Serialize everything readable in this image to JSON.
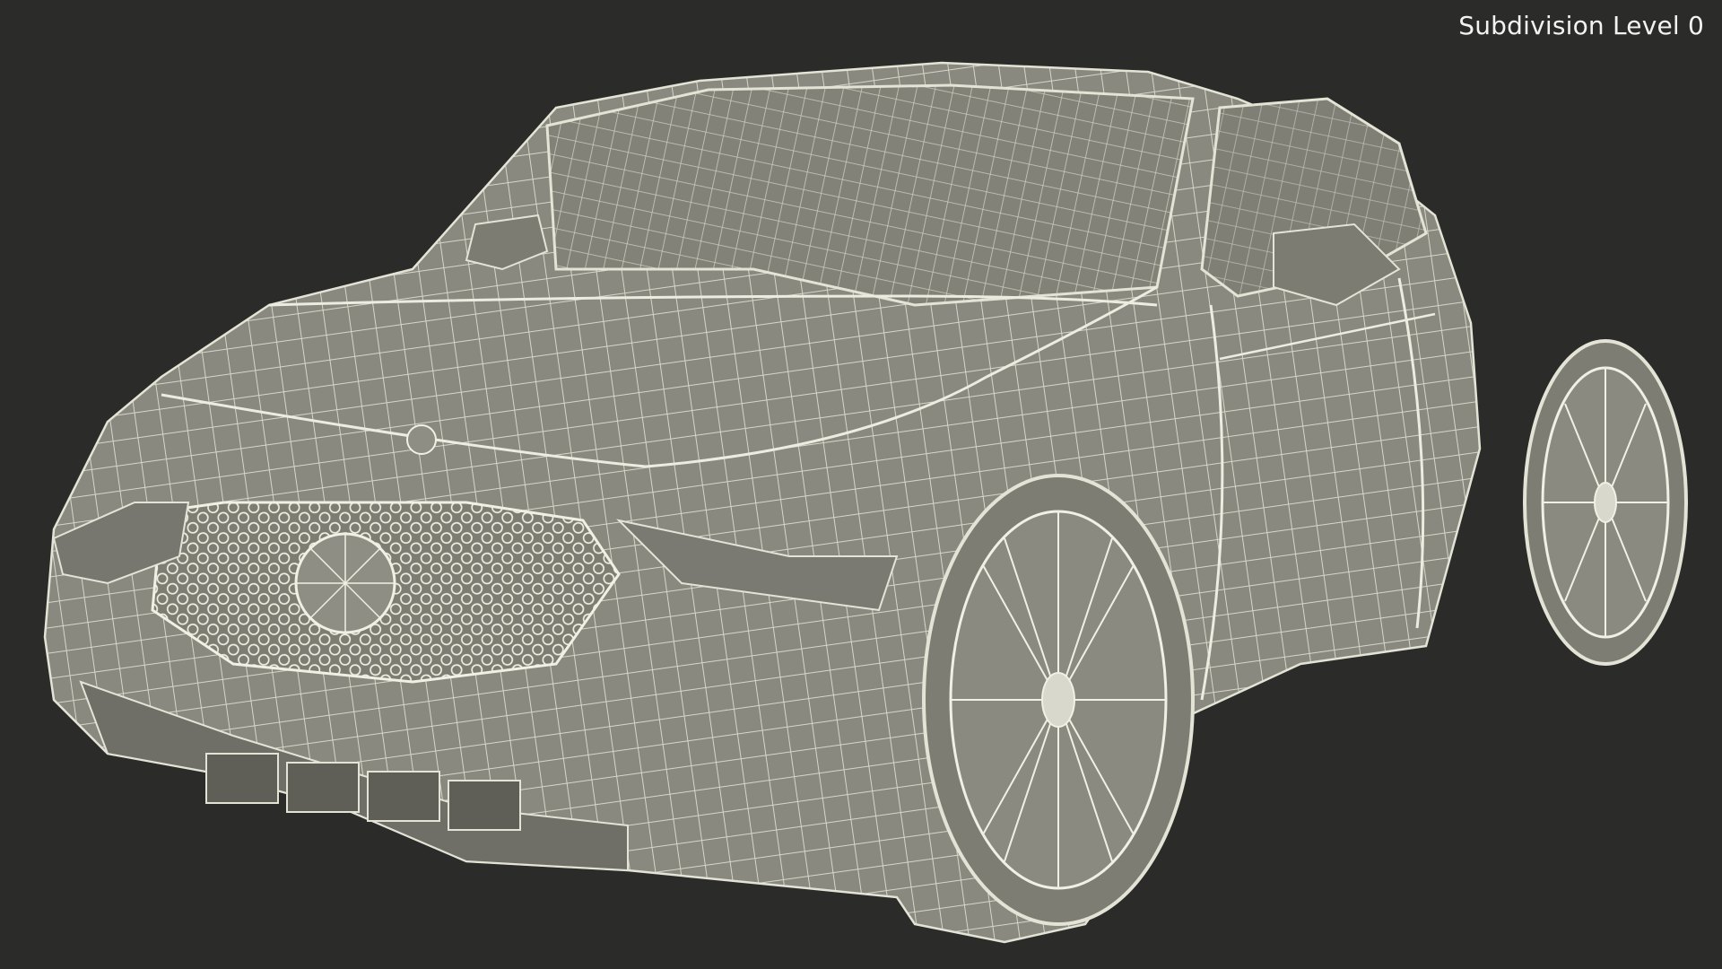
{
  "overlay": {
    "label": "Subdivision Level 0"
  },
  "scene": {
    "subject": "car-wireframe-render",
    "background_color": "#2b2b2a",
    "surface_color": "#8b8b80",
    "wire_color": "#e3e3d6"
  }
}
